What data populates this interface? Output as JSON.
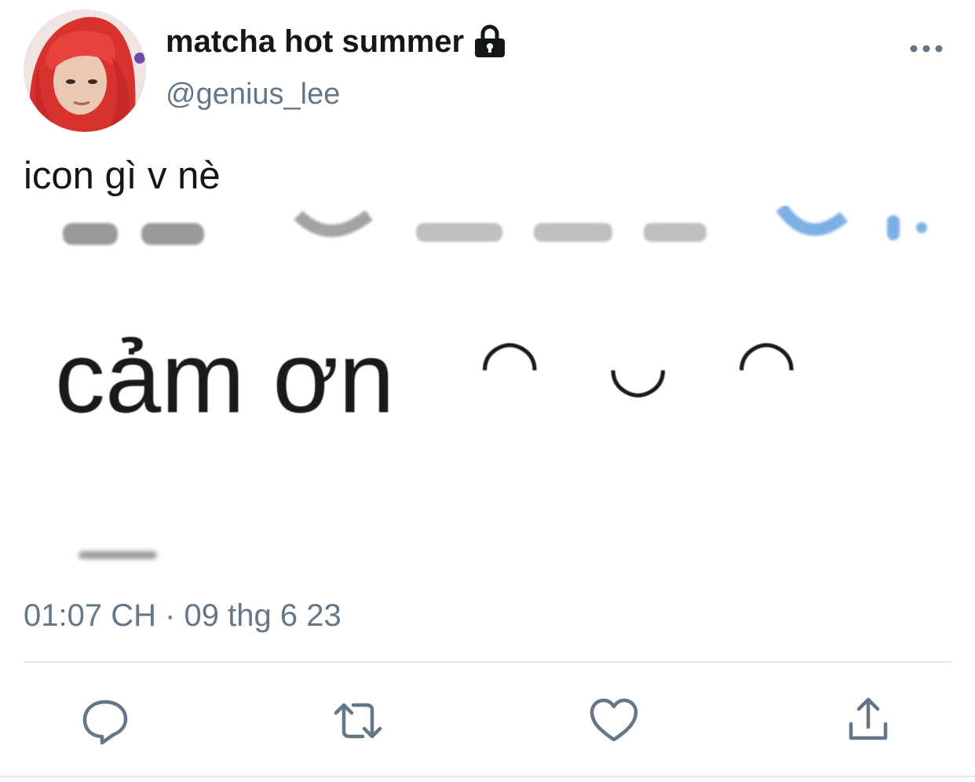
{
  "tweet": {
    "author": {
      "display_name": "matcha hot summer",
      "handle": "@genius_lee",
      "protected_icon": "lock-icon",
      "avatar_icon": "avatar-photo"
    },
    "menu_icon": "more-dots-icon",
    "text": "icon gì v nè",
    "media": {
      "main_text": "cảm ơn",
      "emoticon": "◠ ◡ ◠"
    },
    "timestamp": "01:07 CH · 09 thg 6 23"
  },
  "actions": [
    {
      "icon": "reply-icon"
    },
    {
      "icon": "retweet-icon"
    },
    {
      "icon": "like-icon"
    },
    {
      "icon": "share-icon"
    }
  ],
  "colors": {
    "text_primary": "#14171a",
    "text_secondary": "#657786",
    "divider": "#e1e8ed",
    "avatar_hair": "#e8413e"
  }
}
